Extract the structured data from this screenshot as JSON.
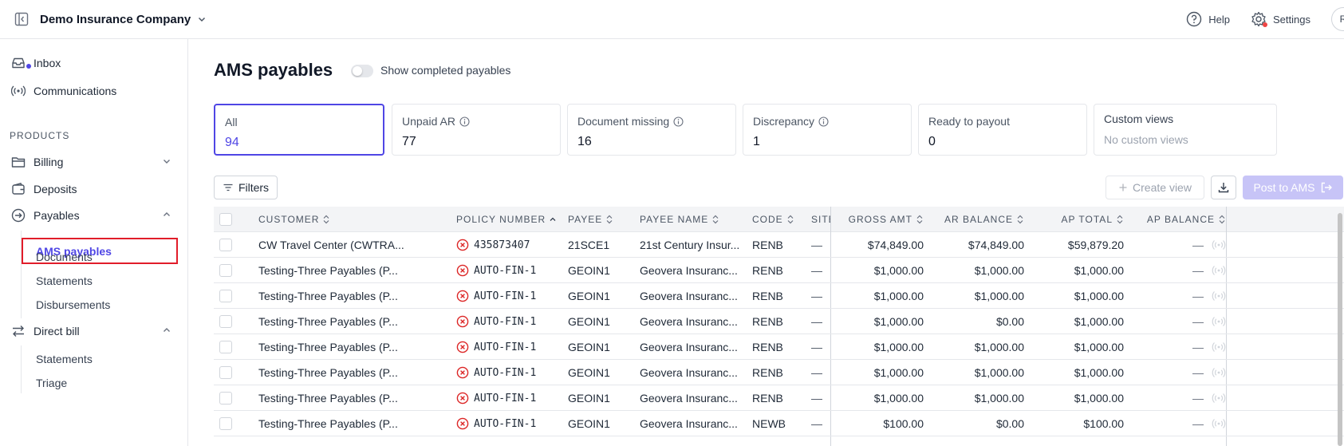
{
  "topbar": {
    "company": "Demo Insurance Company",
    "help": "Help",
    "settings": "Settings",
    "avatar": "R"
  },
  "sidebar": {
    "inbox": "Inbox",
    "communications": "Communications",
    "section": "PRODUCTS",
    "billing": "Billing",
    "deposits": "Deposits",
    "payables": "Payables",
    "payables_sub": [
      "AMS payables",
      "Documents",
      "Statements",
      "Disbursements"
    ],
    "direct_bill": "Direct bill",
    "direct_bill_sub": [
      "Statements",
      "Triage"
    ]
  },
  "main": {
    "title": "AMS payables",
    "toggle_label": "Show completed payables",
    "cards": [
      {
        "label": "All",
        "value": "94"
      },
      {
        "label": "Unpaid AR",
        "value": "77"
      },
      {
        "label": "Document missing",
        "value": "16"
      },
      {
        "label": "Discrepancy",
        "value": "1"
      },
      {
        "label": "Ready to payout",
        "value": "0"
      },
      {
        "label": "Custom views",
        "value": "No custom views"
      }
    ],
    "filters": "Filters",
    "create_view": "Create view",
    "post_to_ams": "Post to AMS"
  },
  "table": {
    "headers": [
      "CUSTOMER",
      "POLICY NUMBER",
      "PAYEE",
      "PAYEE NAME",
      "CODE",
      "SITE",
      "GROSS AMT",
      "AR BALANCE",
      "AP TOTAL",
      "AP BALANCE"
    ],
    "rows": [
      [
        "CW Travel Center (CWTRA...",
        "435873407",
        "21SCE1",
        "21st Century Insur...",
        "RENB",
        "—",
        "$74,849.00",
        "$74,849.00",
        "$59,879.20",
        "—"
      ],
      [
        "Testing-Three Payables (P...",
        "AUTO-FIN-1",
        "GEOIN1",
        "Geovera Insuranc...",
        "RENB",
        "—",
        "$1,000.00",
        "$1,000.00",
        "$1,000.00",
        "—"
      ],
      [
        "Testing-Three Payables (P...",
        "AUTO-FIN-1",
        "GEOIN1",
        "Geovera Insuranc...",
        "RENB",
        "—",
        "$1,000.00",
        "$1,000.00",
        "$1,000.00",
        "—"
      ],
      [
        "Testing-Three Payables (P...",
        "AUTO-FIN-1",
        "GEOIN1",
        "Geovera Insuranc...",
        "RENB",
        "—",
        "$1,000.00",
        "$0.00",
        "$1,000.00",
        "—"
      ],
      [
        "Testing-Three Payables (P...",
        "AUTO-FIN-1",
        "GEOIN1",
        "Geovera Insuranc...",
        "RENB",
        "—",
        "$1,000.00",
        "$1,000.00",
        "$1,000.00",
        "—"
      ],
      [
        "Testing-Three Payables (P...",
        "AUTO-FIN-1",
        "GEOIN1",
        "Geovera Insuranc...",
        "RENB",
        "—",
        "$1,000.00",
        "$1,000.00",
        "$1,000.00",
        "—"
      ],
      [
        "Testing-Three Payables (P...",
        "AUTO-FIN-1",
        "GEOIN1",
        "Geovera Insuranc...",
        "RENB",
        "—",
        "$1,000.00",
        "$1,000.00",
        "$1,000.00",
        "—"
      ],
      [
        "Testing-Three Payables (P...",
        "AUTO-FIN-1",
        "GEOIN1",
        "Geovera Insuranc...",
        "NEWB",
        "—",
        "$100.00",
        "$0.00",
        "$100.00",
        "—"
      ]
    ]
  },
  "colors": {
    "accent": "#4f46e5",
    "error": "#dc2626",
    "highlight": "#e11d2a"
  }
}
